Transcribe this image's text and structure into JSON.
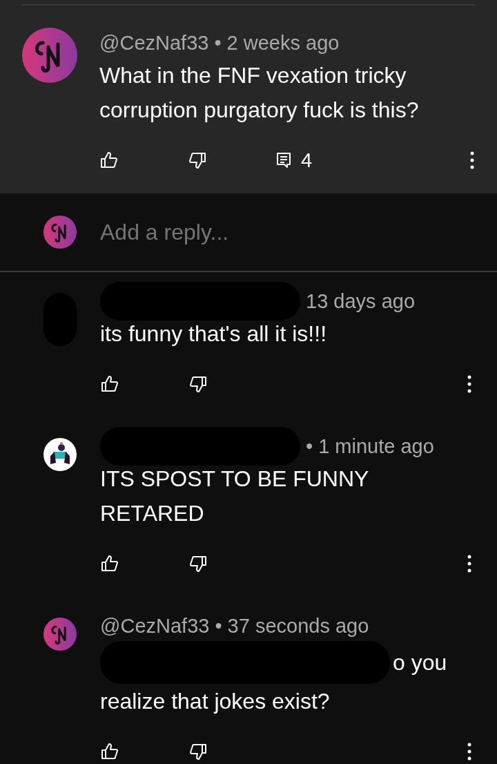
{
  "comment": {
    "avatar": {
      "kind": "monogram"
    },
    "author": "@CezNaf33",
    "separator": "•",
    "time": "2 weeks ago",
    "body": [
      {
        "text": "What in the FNF vexation tricky",
        "redacted": false
      },
      {
        "text": "corruption purgatory fuck is this?",
        "redacted": false
      }
    ],
    "reply_count": "4"
  },
  "reply_box": {
    "avatar": {
      "kind": "monogram"
    },
    "placeholder": "Add a reply..."
  },
  "replies": [
    {
      "avatar": {
        "kind": "redacted"
      },
      "author_redacted": true,
      "time": "13 days ago",
      "body": [
        {
          "text": "its funny that's all it is!!!",
          "redacted": false
        }
      ]
    },
    {
      "avatar": {
        "kind": "figure"
      },
      "author_redacted": true,
      "separator": "•",
      "time": "1 minute ago",
      "body": [
        {
          "text": "ITS SPOST TO BE FUNNY",
          "redacted": false
        },
        {
          "text": "RETARED",
          "redacted": false
        }
      ]
    },
    {
      "avatar": {
        "kind": "monogram"
      },
      "author": "@CezNaf33",
      "separator": "•",
      "time": "37 seconds ago",
      "body": [
        {
          "text": "o you",
          "redacted": true
        },
        {
          "text": "realize that jokes exist?",
          "redacted": false
        }
      ]
    }
  ]
}
